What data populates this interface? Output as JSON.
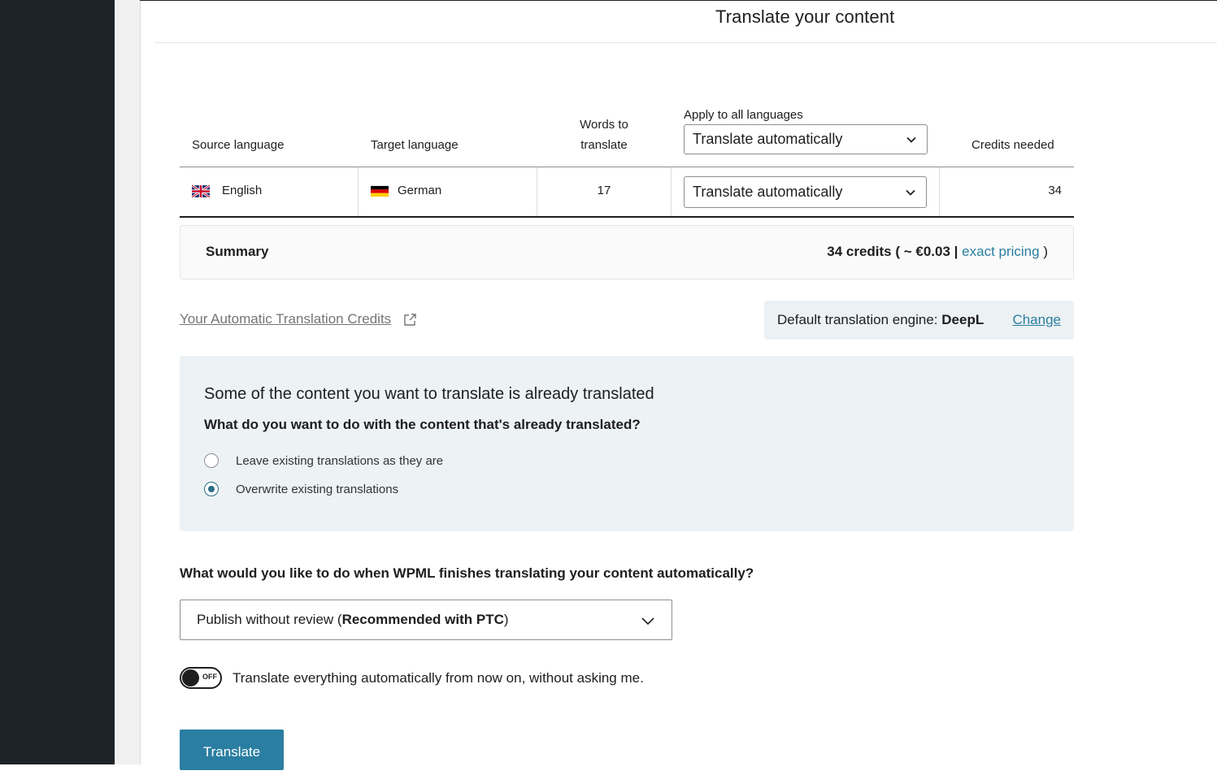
{
  "page": {
    "title": "Translate your content"
  },
  "table": {
    "headers": {
      "source": "Source language",
      "target": "Target language",
      "words_line1": "Words to",
      "words_line2": "translate",
      "apply_all": "Apply to all languages",
      "credits": "Credits needed"
    },
    "apply_all_select": "Translate automatically",
    "rows": [
      {
        "source": "English",
        "target": "German",
        "words": "17",
        "method": "Translate automatically",
        "credits": "34"
      }
    ]
  },
  "summary": {
    "label": "Summary",
    "value_prefix": "34 credits ( ~ €0.03 |",
    "pricing_link": "exact pricing",
    "value_suffix": ")"
  },
  "credits_link": "Your Automatic Translation Credits",
  "engine": {
    "label": "Default translation engine:",
    "name": "DeepL",
    "change": "Change"
  },
  "notice": {
    "title": "Some of the content you want to translate is already translated",
    "question": "What do you want to do with the content that's already translated?",
    "options": [
      {
        "label": "Leave existing translations as they are",
        "checked": false
      },
      {
        "label": "Overwrite existing translations",
        "checked": true
      }
    ]
  },
  "review": {
    "question": "What would you like to do when WPML finishes translating your content automatically?",
    "selected_prefix": "Publish without review (",
    "selected_bold": "Recommended with PTC",
    "selected_suffix": ")"
  },
  "toggle": {
    "state": "OFF",
    "label": "Translate everything automatically from now on, without asking me."
  },
  "translate_button": "Translate",
  "colors": {
    "accent": "#2a7ea1",
    "sidebar": "#1d2327",
    "notice_bg": "#edf2f4",
    "engine_bg": "#ecf1f3"
  }
}
